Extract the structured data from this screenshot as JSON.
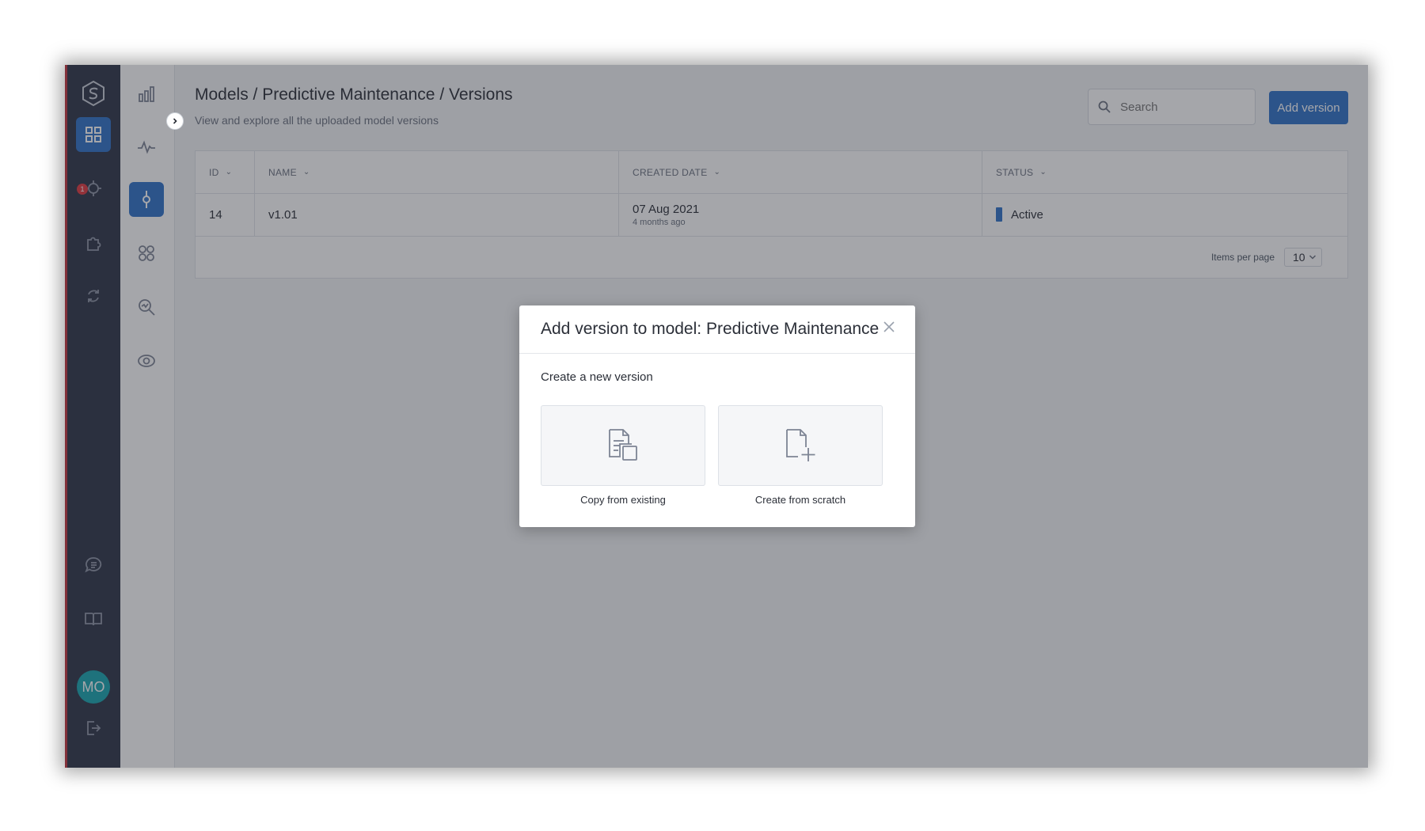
{
  "breadcrumb": "Models / Predictive Maintenance / Versions",
  "subtitle": "View and explore all the uploaded model versions",
  "search": {
    "placeholder": "Search"
  },
  "add_button_label": "Add version",
  "notification_count": "1",
  "user_initials": "MO",
  "table": {
    "headers": [
      "ID",
      "NAME",
      "CREATED DATE",
      "STATUS"
    ],
    "rows": [
      {
        "id": "14",
        "name": "v1.01",
        "created": "07 Aug 2021",
        "created_relative": "4 months ago",
        "status": "Active"
      }
    ],
    "items_per_page_label": "Items per page",
    "items_per_page_value": "10"
  },
  "modal": {
    "title": "Add version to model: Predictive Maintenance",
    "section_label": "Create a new version",
    "options": [
      {
        "label": "Copy from existing",
        "icon": "copy-document-icon"
      },
      {
        "label": "Create from scratch",
        "icon": "new-document-icon"
      }
    ]
  },
  "colors": {
    "accent": "#2f72c9",
    "rail": "#2e3448",
    "avatar": "#17a6b0",
    "badge": "#e0383e"
  }
}
